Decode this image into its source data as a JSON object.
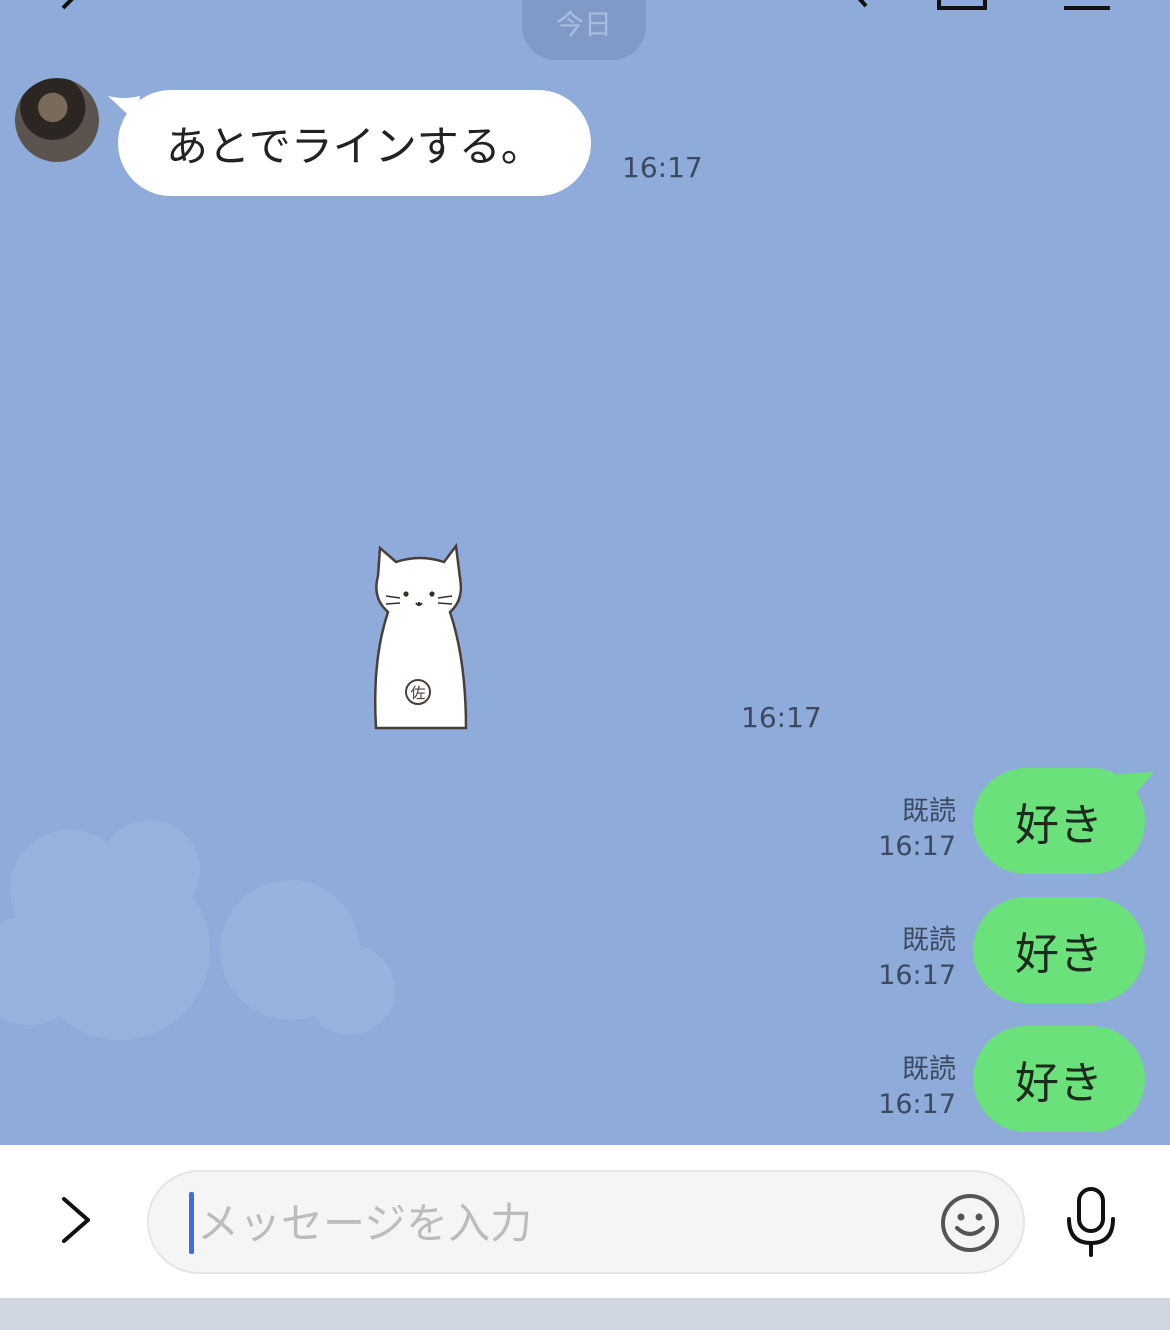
{
  "header": {
    "date_label": "今日"
  },
  "messages": {
    "incoming": {
      "text": "あとでラインする。",
      "time": "16:17"
    },
    "sticker": {
      "name": "white-cat-sticker",
      "time": "16:17"
    },
    "outgoing": [
      {
        "text": "好き",
        "read": "既読",
        "time": "16:17"
      },
      {
        "text": "好き",
        "read": "既読",
        "time": "16:17"
      },
      {
        "text": "好き",
        "read": "既読",
        "time": "16:17"
      }
    ]
  },
  "input": {
    "placeholder": "メッセージを入力"
  },
  "colors": {
    "chat_bg": "#8fabda",
    "incoming_bubble": "#ffffff",
    "outgoing_bubble": "#6ae17b",
    "caret": "#3b6ee0"
  },
  "icons": [
    "back-arrow-icon",
    "search-icon",
    "call-icon",
    "menu-icon",
    "chevron-right-icon",
    "smile-icon",
    "microphone-icon"
  ]
}
